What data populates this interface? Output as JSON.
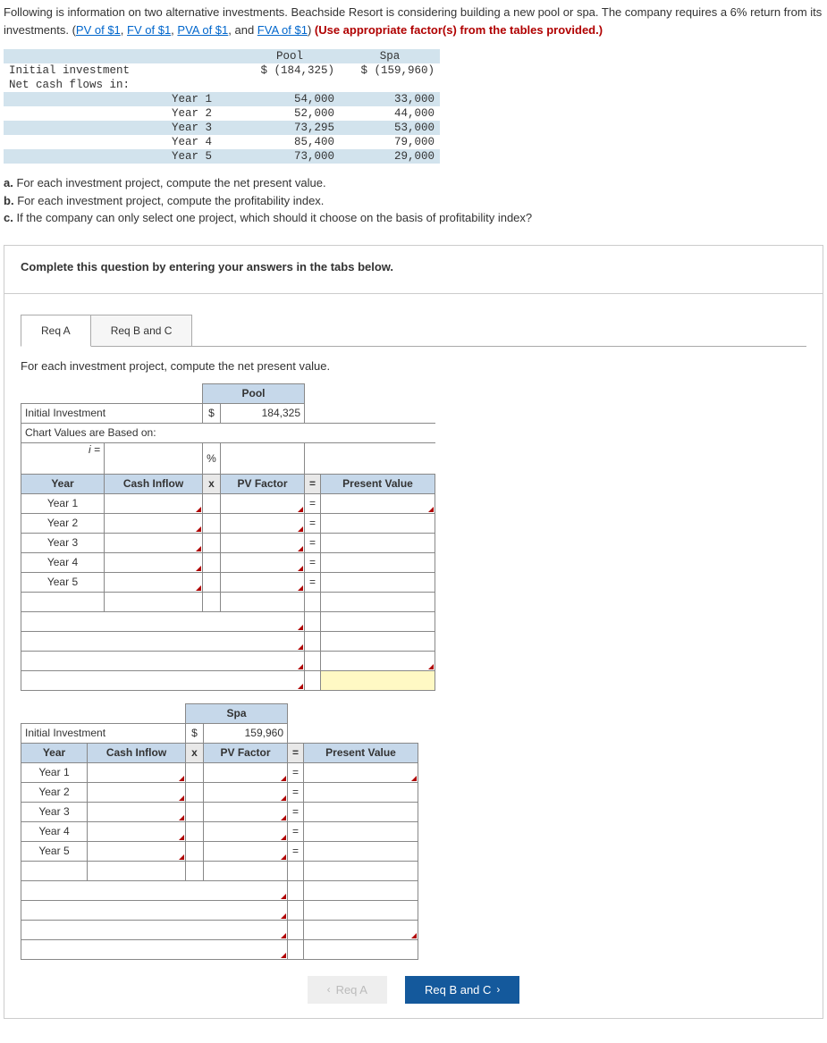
{
  "intro": {
    "text1": "Following is information on two alternative investments. Beachside Resort is considering building a new pool or spa. The company requires a 6% return from its investments. (",
    "link1": "PV of $1",
    "sep": ", ",
    "link2": "FV of $1",
    "link3": "PVA of $1",
    "and": ", and ",
    "link4": "FVA of $1",
    "close": ") ",
    "red": "(Use appropriate factor(s) from the tables provided.)"
  },
  "cols": {
    "pool": "Pool",
    "spa": "Spa"
  },
  "rows": {
    "init": "Initial investment",
    "init_pool": "$ (184,325)",
    "init_spa": "$ (159,960)",
    "ncf": "Net cash flows in:",
    "years": [
      "Year 1",
      "Year 2",
      "Year 3",
      "Year 4",
      "Year 5"
    ],
    "pool_vals": [
      "54,000",
      "52,000",
      "73,295",
      "85,400",
      "73,000"
    ],
    "spa_vals": [
      "33,000",
      "44,000",
      "53,000",
      "79,000",
      "29,000"
    ]
  },
  "q": {
    "a_l": "a.",
    "a": "For each investment project, compute the net present value.",
    "b_l": "b.",
    "b": "For each investment project, compute the profitability index.",
    "c_l": "c.",
    "c": "If the company can only select one project, which should it choose on the basis of profitability index?"
  },
  "prompt": "Complete this question by entering your answers in the tabs below.",
  "tabs": {
    "a": "Req A",
    "bc": "Req B and C"
  },
  "instr": "For each investment project, compute the net present value.",
  "fields": {
    "init_inv": "Initial Investment",
    "chart_based": "Chart Values are Based on:",
    "i_eq": "i =",
    "pct": "%",
    "year": "Year",
    "cash_inflow": "Cash Inflow",
    "x": "x",
    "pv_factor": "PV Factor",
    "eq": "=",
    "present_value": "Present Value",
    "dollar": "$",
    "pool_amt": "184,325",
    "spa_amt": "159,960",
    "years": [
      "Year 1",
      "Year 2",
      "Year 3",
      "Year 4",
      "Year 5"
    ],
    "pool": "Pool",
    "spa": "Spa"
  },
  "nav": {
    "prev": "Req A",
    "next": "Req B and C"
  }
}
